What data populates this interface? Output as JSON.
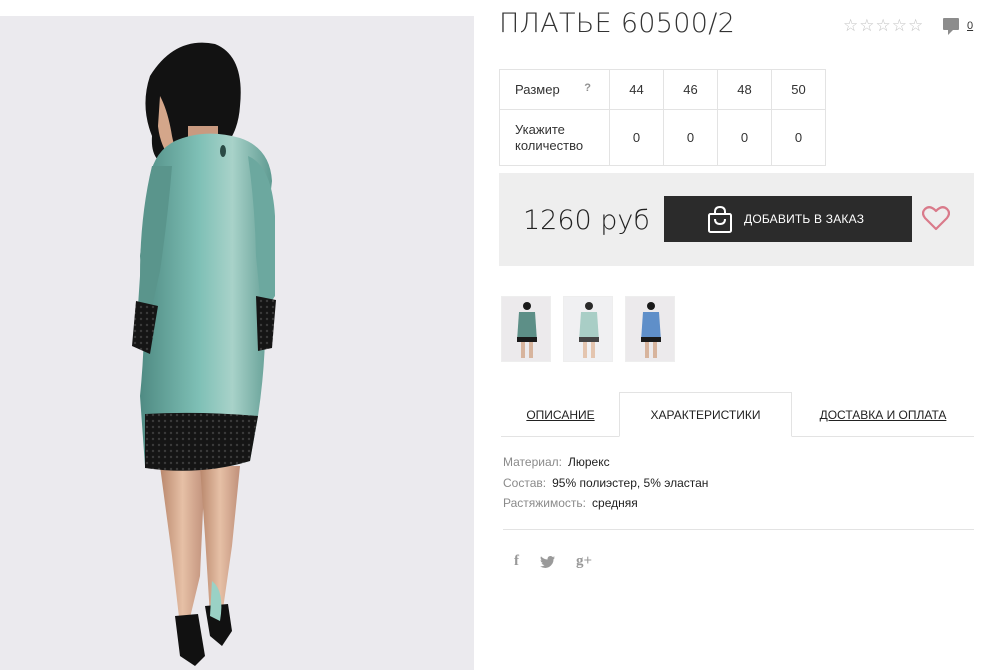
{
  "product": {
    "title": "ПЛАТЬЕ 60500/2",
    "rating_icon": "star-outline-icon",
    "reviews_count": "0",
    "reviews_icon": "comment-icon"
  },
  "sizes": {
    "size_label": "Размер",
    "help": "?",
    "values": [
      "44",
      "46",
      "48",
      "50"
    ],
    "qty_label_line1": "Укажите",
    "qty_label_line2": "количество",
    "quantities": [
      "0",
      "0",
      "0",
      "0"
    ]
  },
  "purchase": {
    "price": "1260 руб",
    "add_button": "ДОБАВИТЬ В ЗАКАЗ",
    "bag_icon": "shopping-bag-icon",
    "wishlist_icon": "heart-icon",
    "wishlist_color": "#d97a8a"
  },
  "tabs": {
    "description": "ОПИСАНИЕ",
    "characteristics": "ХАРАКТЕРИСТИКИ",
    "delivery": "ДОСТАВКА И ОПЛАТА",
    "active": "characteristics"
  },
  "characteristics": [
    {
      "key": "Материал:",
      "value": "Люрекс"
    },
    {
      "key": "Состав:",
      "value": "95% полиэстер, 5% эластан"
    },
    {
      "key": "Растяжимость:",
      "value": "средняя"
    }
  ],
  "social": {
    "facebook": "f",
    "twitter_icon": "twitter-icon",
    "google_plus": "g+"
  },
  "colors": {
    "dress": "#5f9e95",
    "lace": "#1a1a1a",
    "button_bg": "#2b2b2b",
    "price_box_bg": "#eeeeee"
  }
}
